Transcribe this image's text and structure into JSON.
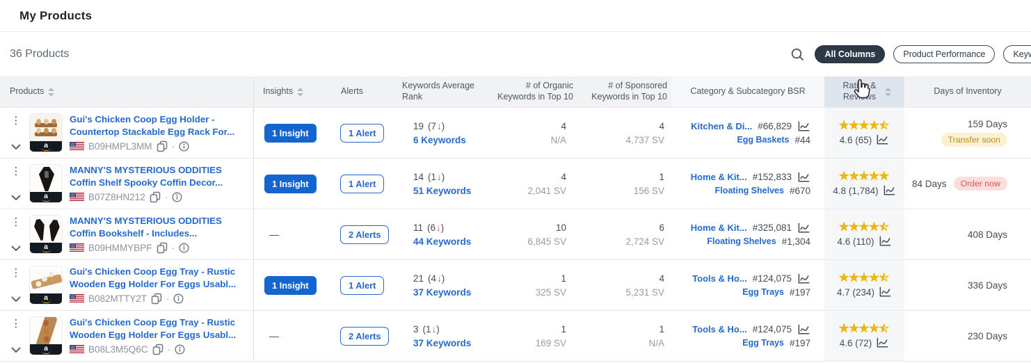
{
  "page": {
    "title": "My Products",
    "product_count": "36 Products"
  },
  "toolbar": {
    "buttons": [
      {
        "label": "All Columns",
        "active": "true"
      },
      {
        "label": "Product Performance",
        "active": "false"
      },
      {
        "label": "Keywo",
        "active": "false"
      }
    ]
  },
  "table": {
    "columns": [
      {
        "label": "Products"
      },
      {
        "label": "Insights"
      },
      {
        "label": "Alerts"
      },
      {
        "label": "Keywords Average Rank"
      },
      {
        "label": "# of Organic Keywords in Top 10"
      },
      {
        "label": "# of Sponsored Keywords in Top 10"
      },
      {
        "label": "Category & Subcategory BSR"
      },
      {
        "label": "Rating & Reviews"
      },
      {
        "label": "Days of Inventory"
      }
    ],
    "rows": [
      {
        "title": "Gui's Chicken Coop Egg Holder - Countertop Stackable Egg Rack For...",
        "asin": "B09HMPL3MM",
        "thumb": "egg-rack",
        "insight": "1 Insight",
        "insight_kind": "button",
        "alert": "1 Alert",
        "rank": "19",
        "rank_drop": "7",
        "keywords": "6 Keywords",
        "organic_top10": "4",
        "organic_sv": "N/A",
        "sponsored_top10": "4",
        "sponsored_sv": "4,737 SV",
        "category": "Kitchen & Di...",
        "category_rank": "#66,829",
        "subcategory": "Egg Baskets",
        "subcategory_rank": "#44",
        "rating": "4.6 (65)",
        "stars_style": "width:90%",
        "days": "159 Days",
        "badge": "Transfer soon",
        "badge_kind": "warning",
        "inv_layout": "stack"
      },
      {
        "title": "MANNY'S MYSTERIOUS ODDITIES Coffin Shelf Spooky Coffin Decor...",
        "asin": "B07Z8HN212",
        "thumb": "coffin",
        "insight": "1 Insight",
        "insight_kind": "button",
        "alert": "1 Alert",
        "rank": "14",
        "rank_drop": "1",
        "keywords": "51 Keywords",
        "organic_top10": "4",
        "organic_sv": "2,041 SV",
        "sponsored_top10": "1",
        "sponsored_sv": "156 SV",
        "category": "Home & Kit...",
        "category_rank": "#152,833",
        "subcategory": "Floating Shelves",
        "subcategory_rank": "#670",
        "rating": "4.8 (1,784)",
        "stars_style": "width:100%",
        "days": "84 Days",
        "badge": "Order now",
        "badge_kind": "danger",
        "inv_layout": "inline"
      },
      {
        "title": "MANNY'S MYSTERIOUS ODDITIES Coffin Bookshelf - Includes...",
        "asin": "B09HMMYBPF",
        "thumb": "two-coffins",
        "insight": "—",
        "insight_kind": "dash",
        "alert": "2 Alerts",
        "rank": "11",
        "rank_drop": "6",
        "keywords": "44 Keywords",
        "organic_top10": "10",
        "organic_sv": "6,845 SV",
        "sponsored_top10": "6",
        "sponsored_sv": "2,724 SV",
        "category": "Home & Kit...",
        "category_rank": "#325,081",
        "subcategory": "Floating Shelves",
        "subcategory_rank": "#1,304",
        "rating": "4.6 (110)",
        "stars_style": "width:90%",
        "days": "408 Days",
        "badge": "",
        "badge_kind": "none",
        "inv_layout": "stack"
      },
      {
        "title": "Gui's Chicken Coop Egg Tray - Rustic Wooden Egg Holder For Eggs Usabl...",
        "asin": "B082MTTY2T",
        "thumb": "egg-tray-flat",
        "insight": "1 Insight",
        "insight_kind": "button",
        "alert": "1 Alert",
        "rank": "21",
        "rank_drop": "4",
        "keywords": "37 Keywords",
        "organic_top10": "1",
        "organic_sv": "325 SV",
        "sponsored_top10": "4",
        "sponsored_sv": "5,231 SV",
        "category": "Tools & Ho...",
        "category_rank": "#124,075",
        "subcategory": "Egg Trays",
        "subcategory_rank": "#197",
        "rating": "4.7 (234)",
        "stars_style": "width:90%",
        "days": "336 Days",
        "badge": "",
        "badge_kind": "none",
        "inv_layout": "stack"
      },
      {
        "title": "Gui's Chicken Coop Egg Tray - Rustic Wooden Egg Holder For Eggs Usabl...",
        "asin": "B08L3M5Q6C",
        "thumb": "egg-tray-angled",
        "insight": "—",
        "insight_kind": "dash",
        "alert": "2 Alerts",
        "rank": "3",
        "rank_drop": "1",
        "keywords": "37 Keywords",
        "organic_top10": "1",
        "organic_sv": "169 SV",
        "sponsored_top10": "1",
        "sponsored_sv": "N/A",
        "category": "Tools & Ho...",
        "category_rank": "#124,075",
        "subcategory": "Egg Trays",
        "subcategory_rank": "#197",
        "rating": "4.6 (72)",
        "stars_style": "width:90%",
        "days": "230 Days",
        "badge": "",
        "badge_kind": "none",
        "inv_layout": "stack"
      }
    ]
  }
}
